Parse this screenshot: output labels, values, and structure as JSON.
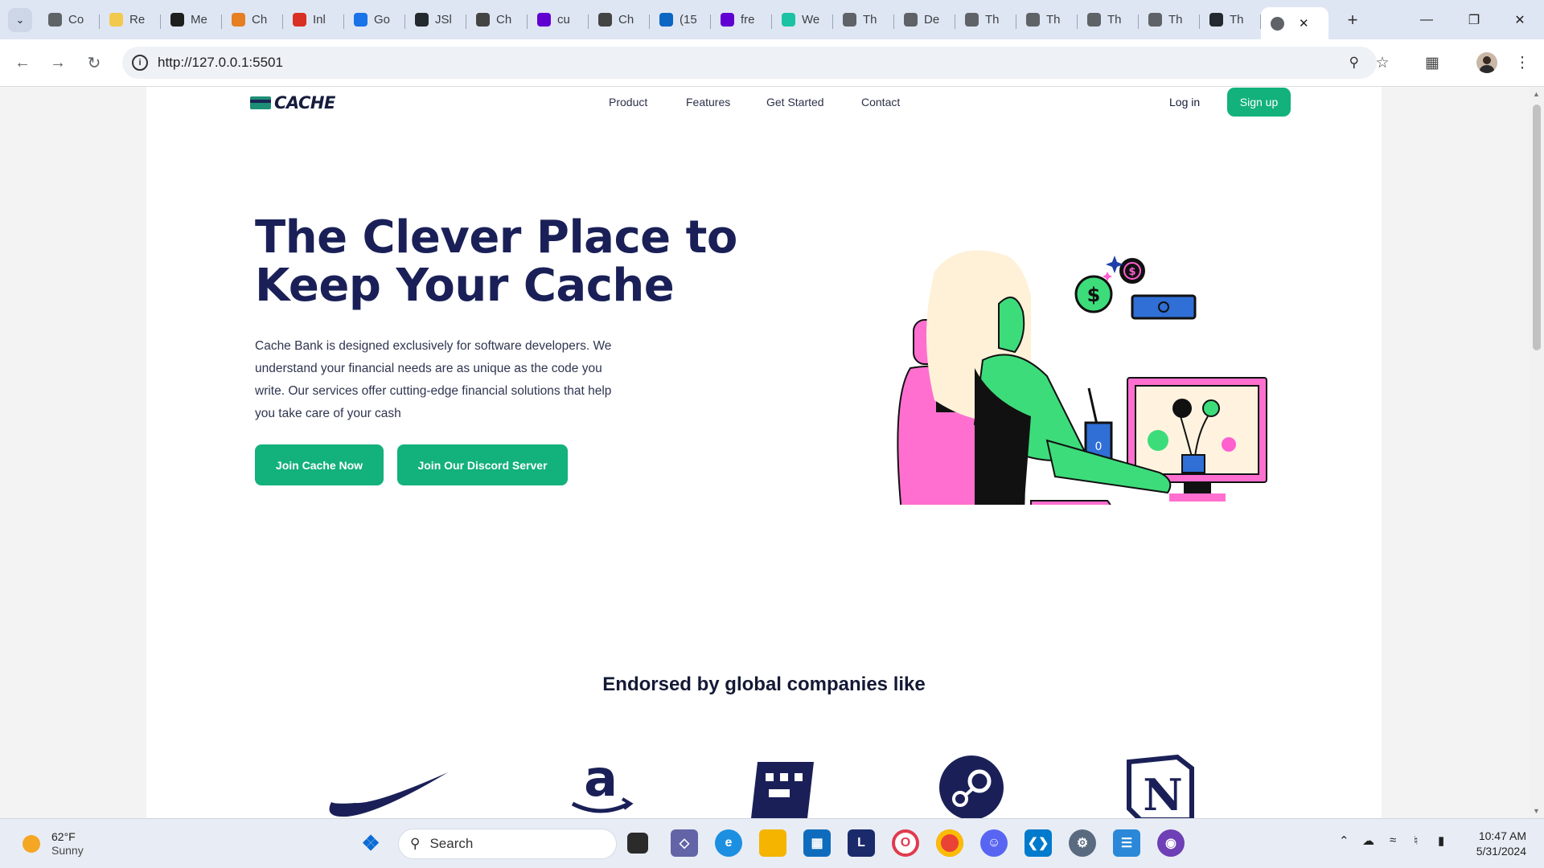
{
  "browser": {
    "tabs": [
      {
        "label": "Co",
        "icon": "globe-icon",
        "color": "#5f6368"
      },
      {
        "label": "Re",
        "icon": "notes-icon",
        "color": "#f2c94c"
      },
      {
        "label": "Me",
        "icon": "figma-icon",
        "color": "#1e1e1e"
      },
      {
        "label": "Ch",
        "icon": "rainbow-icon",
        "color": "#e67e22"
      },
      {
        "label": "Inl",
        "icon": "gmail-icon",
        "color": "#d93025"
      },
      {
        "label": "Go",
        "icon": "calendar-icon",
        "color": "#1a73e8"
      },
      {
        "label": "JSl",
        "icon": "github-icon",
        "color": "#24292f"
      },
      {
        "label": "Ch",
        "icon": "chatgpt-icon",
        "color": "#444444"
      },
      {
        "label": "cu",
        "icon": "yahoo-icon",
        "color": "#6001d2"
      },
      {
        "label": "Ch",
        "icon": "chatgpt-icon",
        "color": "#444444"
      },
      {
        "label": "(15",
        "icon": "linkedin-icon",
        "color": "#0a66c2"
      },
      {
        "label": "fre",
        "icon": "yahoo-icon",
        "color": "#6001d2"
      },
      {
        "label": "We",
        "icon": "webflow-icon",
        "color": "#19c3a4"
      },
      {
        "label": "Th",
        "icon": "globe-icon",
        "color": "#5f6368"
      },
      {
        "label": "De",
        "icon": "globe-icon",
        "color": "#5f6368"
      },
      {
        "label": "Th",
        "icon": "globe-icon",
        "color": "#5f6368"
      },
      {
        "label": "Th",
        "icon": "globe-icon",
        "color": "#5f6368"
      },
      {
        "label": "Th",
        "icon": "globe-icon",
        "color": "#5f6368"
      },
      {
        "label": "Th",
        "icon": "globe-icon",
        "color": "#5f6368"
      },
      {
        "label": "Th",
        "icon": "github-icon",
        "color": "#24292f"
      }
    ],
    "active_tab_icon": "globe-icon",
    "url": "http://127.0.0.1:5501"
  },
  "site": {
    "logo_text": "CACHE",
    "nav": [
      "Product",
      "Features",
      "Get Started",
      "Contact"
    ],
    "login_label": "Log in",
    "signup_label": "Sign up",
    "hero": {
      "title": "The Clever Place to Keep Your Cache",
      "text": "Cache Bank is designed exclusively for software developers. We understand your financial needs are as unique as the code you write. Our services offer cutting-edge financial solutions that help you take care of your cash",
      "primary_cta": "Join Cache Now",
      "secondary_cta": "Join Our Discord Server"
    },
    "endorsed_heading": "Endorsed by global companies like",
    "partner_logos": [
      "nike-logo",
      "amazon-logo",
      "minecraft-logo",
      "steam-logo",
      "notion-logo"
    ],
    "accent_color": "#13b17c",
    "heading_color": "#1a2057"
  },
  "taskbar": {
    "weather_temp": "62°F",
    "weather_condition": "Sunny",
    "search_placeholder": "Search",
    "time": "10:47 AM",
    "date": "5/31/2024"
  }
}
